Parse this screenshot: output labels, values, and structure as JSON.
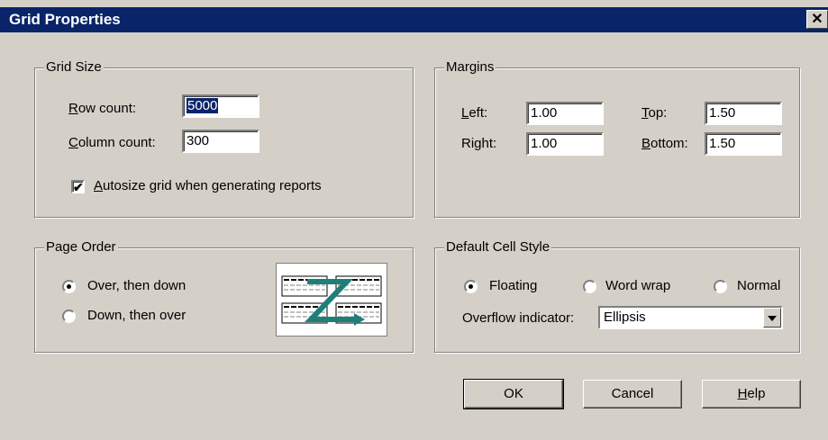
{
  "window": {
    "title": "Grid Properties",
    "close_glyph": "✕"
  },
  "grid_size": {
    "title": "Grid Size",
    "row_count": {
      "mnemonic": "R",
      "rest": "ow count:",
      "value": "5000"
    },
    "column_count": {
      "mnemonic": "C",
      "rest": "olumn count:",
      "value": "300"
    },
    "autosize": {
      "mnemonic": "A",
      "rest": "utosize grid when generating reports",
      "checked": true
    }
  },
  "margins": {
    "title": "Margins",
    "left": {
      "mnemonic": "L",
      "rest": "eft:",
      "value": "1.00"
    },
    "right": {
      "label": "Right:",
      "value": "1.00"
    },
    "top": {
      "mnemonic": "T",
      "rest": "op:",
      "value": "1.50"
    },
    "bottom": {
      "mnemonic": "B",
      "rest": "ottom:",
      "value": "1.50"
    }
  },
  "page_order": {
    "title": "Page Order",
    "options": [
      {
        "label": "Over, then down",
        "checked": true
      },
      {
        "label": "Down, then over",
        "checked": false
      }
    ],
    "icon": "page-order-z-icon"
  },
  "default_cell_style": {
    "title": "Default Cell Style",
    "options": [
      {
        "label": "Floating",
        "checked": true
      },
      {
        "label": "Word wrap",
        "checked": false
      },
      {
        "label": "Normal",
        "checked": false
      }
    ],
    "overflow_label": "Overflow indicator:",
    "overflow_value": "Ellipsis"
  },
  "buttons": {
    "ok": "OK",
    "cancel": "Cancel",
    "help_mnemonic": "H",
    "help_rest": "elp"
  },
  "colors": {
    "titlebar": "#0a246a",
    "face": "#d4d0c8",
    "accent_icon": "#1e7f7a"
  }
}
